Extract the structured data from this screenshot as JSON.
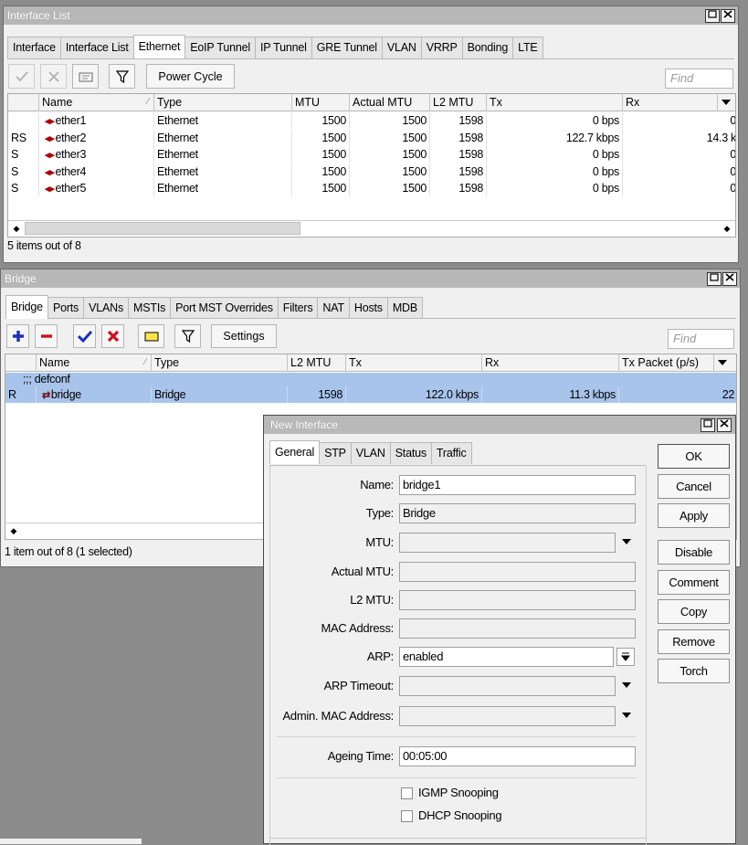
{
  "interface_window": {
    "title": "Interface List",
    "tabs": [
      "Interface",
      "Interface List",
      "Ethernet",
      "EoIP Tunnel",
      "IP Tunnel",
      "GRE Tunnel",
      "VLAN",
      "VRRP",
      "Bonding",
      "LTE"
    ],
    "active_tab": "Ethernet",
    "power_cycle_label": "Power Cycle",
    "find_placeholder": "Find",
    "columns": [
      "Name",
      "Type",
      "MTU",
      "Actual MTU",
      "L2 MTU",
      "Tx",
      "Rx"
    ],
    "rows": [
      {
        "flags": "",
        "name": "ether1",
        "type": "Ethernet",
        "mtu": "1500",
        "actual_mtu": "1500",
        "l2mtu": "1598",
        "tx": "0 bps",
        "rx": "0"
      },
      {
        "flags": "RS",
        "name": "ether2",
        "type": "Ethernet",
        "mtu": "1500",
        "actual_mtu": "1500",
        "l2mtu": "1598",
        "tx": "122.7 kbps",
        "rx": "14.3 k"
      },
      {
        "flags": "S",
        "name": "ether3",
        "type": "Ethernet",
        "mtu": "1500",
        "actual_mtu": "1500",
        "l2mtu": "1598",
        "tx": "0 bps",
        "rx": "0"
      },
      {
        "flags": "S",
        "name": "ether4",
        "type": "Ethernet",
        "mtu": "1500",
        "actual_mtu": "1500",
        "l2mtu": "1598",
        "tx": "0 bps",
        "rx": "0"
      },
      {
        "flags": "S",
        "name": "ether5",
        "type": "Ethernet",
        "mtu": "1500",
        "actual_mtu": "1500",
        "l2mtu": "1598",
        "tx": "0 bps",
        "rx": "0"
      }
    ],
    "status": "5 items out of 8"
  },
  "bridge_window": {
    "title": "Bridge",
    "tabs": [
      "Bridge",
      "Ports",
      "VLANs",
      "MSTIs",
      "Port MST Overrides",
      "Filters",
      "NAT",
      "Hosts",
      "MDB"
    ],
    "active_tab": "Bridge",
    "settings_label": "Settings",
    "find_placeholder": "Find",
    "columns": [
      "Name",
      "Type",
      "L2 MTU",
      "Tx",
      "Rx",
      "Tx Packet (p/s)"
    ],
    "comment_row": ";;; defconf",
    "rows": [
      {
        "flags": "R",
        "name": "bridge",
        "type": "Bridge",
        "l2mtu": "1598",
        "tx": "122.0 kbps",
        "rx": "11.3 kbps",
        "tx_packet": "22"
      }
    ],
    "status": "1 item out of 8 (1 selected)"
  },
  "new_interface_dialog": {
    "title": "New Interface",
    "tabs": [
      "General",
      "STP",
      "VLAN",
      "Status",
      "Traffic"
    ],
    "active_tab": "General",
    "labels": {
      "name": "Name:",
      "type": "Type:",
      "mtu": "MTU:",
      "actual_mtu": "Actual MTU:",
      "l2mtu": "L2 MTU:",
      "mac": "MAC Address:",
      "arp": "ARP:",
      "arp_timeout": "ARP Timeout:",
      "admin_mac": "Admin. MAC Address:",
      "ageing": "Ageing Time:"
    },
    "values": {
      "name": "bridge1",
      "type": "Bridge",
      "mtu": "",
      "actual_mtu": "",
      "l2mtu": "",
      "mac": "",
      "arp": "enabled",
      "arp_timeout": "",
      "admin_mac": "",
      "ageing": "00:05:00"
    },
    "checkboxes": [
      {
        "label": "IGMP Snooping",
        "checked": false
      },
      {
        "label": "DHCP Snooping",
        "checked": false
      }
    ],
    "buttons": [
      "OK",
      "Cancel",
      "Apply",
      "Disable",
      "Comment",
      "Copy",
      "Remove",
      "Torch"
    ]
  },
  "colors": {
    "titlebar": "#b7b7b7",
    "selection": "#a9c4eb",
    "desktop": "#8c8c8c",
    "add_icon": "#1b2fbd",
    "remove_icon": "#d0101a"
  }
}
